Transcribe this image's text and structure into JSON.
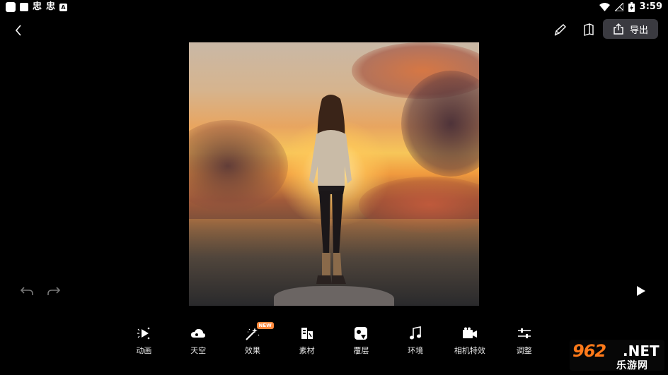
{
  "status_bar": {
    "app_glyphs": [
      "忠",
      "忠"
    ],
    "a_badge": "A",
    "time": "3:59"
  },
  "header": {
    "back_icon": "chevron-left-icon",
    "pen_icon": "pen-icon",
    "book_icon": "book-icon",
    "export_label": "导出"
  },
  "history": {
    "undo_icon": "undo-icon",
    "redo_icon": "redo-icon"
  },
  "play_icon": "play-icon",
  "toolbar": {
    "items": [
      {
        "label": "动画",
        "icon": "animation-icon"
      },
      {
        "label": "天空",
        "icon": "cloud-icon"
      },
      {
        "label": "效果",
        "icon": "magic-wand-icon",
        "badge": "NEW"
      },
      {
        "label": "素材",
        "icon": "materials-icon"
      },
      {
        "label": "覆层",
        "icon": "overlay-icon"
      },
      {
        "label": "环境",
        "icon": "music-note-icon"
      },
      {
        "label": "相机特效",
        "icon": "video-camera-icon"
      },
      {
        "label": "调整",
        "icon": "sliders-icon"
      }
    ]
  },
  "watermark": {
    "logo": "962",
    "suffix": ".NET",
    "sub": "乐游网"
  }
}
